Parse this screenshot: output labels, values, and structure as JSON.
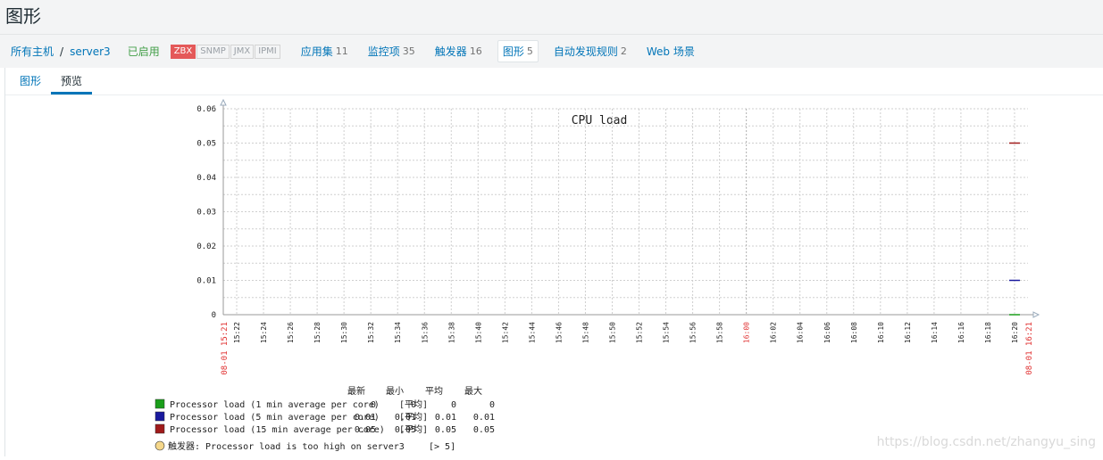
{
  "page": {
    "title": "图形"
  },
  "host_bar": {
    "all_hosts": "所有主机",
    "sep": "/",
    "host": "server3",
    "status": "已启用",
    "availability": [
      {
        "label": "ZBX",
        "on": true
      },
      {
        "label": "SNMP",
        "on": false
      },
      {
        "label": "JMX",
        "on": false
      },
      {
        "label": "IPMI",
        "on": false
      }
    ],
    "links": [
      {
        "label": "应用集",
        "count": "11"
      },
      {
        "label": "监控项",
        "count": "35"
      },
      {
        "label": "触发器",
        "count": "16"
      },
      {
        "label": "图形",
        "count": "5",
        "active": true
      },
      {
        "label": "自动发现规则",
        "count": "2"
      },
      {
        "label": "Web 场景",
        "count": ""
      }
    ]
  },
  "tabs": [
    {
      "label": "图形",
      "active": false
    },
    {
      "label": "预览",
      "active": true
    }
  ],
  "chart_data": {
    "type": "line",
    "title": "CPU load",
    "ylim": [
      0,
      0.06
    ],
    "y_ticks": [
      "0",
      "0.01",
      "0.02",
      "0.03",
      "0.04",
      "0.05",
      "0.06"
    ],
    "x_ticks": [
      "15:22",
      "15:24",
      "15:26",
      "15:28",
      "15:30",
      "15:32",
      "15:34",
      "15:36",
      "15:38",
      "15:40",
      "15:42",
      "15:44",
      "15:46",
      "15:48",
      "15:50",
      "15:52",
      "15:54",
      "15:56",
      "15:58",
      "16:00",
      "16:02",
      "16:04",
      "16:06",
      "16:08",
      "16:10",
      "16:12",
      "16:14",
      "16:16",
      "16:18",
      "16:20"
    ],
    "x_highlight": [
      "16:00"
    ],
    "x_start_label": "08-01 15:21",
    "x_end_label": "08-01 16:21",
    "grid": true,
    "legend_headers": [
      "最新",
      "最小",
      "平均",
      "最大"
    ],
    "series": [
      {
        "name": "Processor load (1 min average per core)",
        "func": "[平均]",
        "color": "#1a9e1a",
        "latest": "0",
        "min": "0",
        "avg": "0",
        "max": "0",
        "values": [
          {
            "x": "16:20",
            "y": 0
          }
        ]
      },
      {
        "name": "Processor load (5 min average per core)",
        "func": "[平均]",
        "color": "#1a1a9e",
        "latest": "0.01",
        "min": "0.01",
        "avg": "0.01",
        "max": "0.01",
        "values": [
          {
            "x": "16:20",
            "y": 0.01
          }
        ]
      },
      {
        "name": "Processor load (15 min average per core)",
        "func": "[平均]",
        "color": "#a01a1a",
        "latest": "0.05",
        "min": "0.05",
        "avg": "0.05",
        "max": "0.05",
        "values": [
          {
            "x": "16:20",
            "y": 0.05
          }
        ]
      }
    ],
    "trigger": {
      "label": "触发器: Processor load is too high on server3",
      "threshold": "[> 5]",
      "color": "#f5d78a"
    }
  },
  "watermark": "https://blog.csdn.net/zhangyu_sing"
}
